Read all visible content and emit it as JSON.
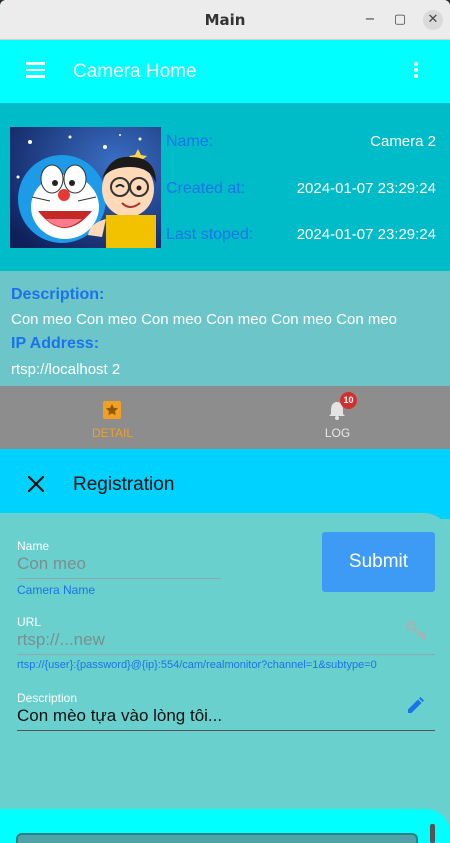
{
  "window": {
    "title": "Main",
    "minimize": "−",
    "maximize": "▢",
    "close": "✕"
  },
  "appbar": {
    "title": "Camera Home",
    "menu_icon": "menu-icon",
    "more_icon": "more-vert-icon"
  },
  "camera": {
    "thumbnail": "doraemon-nobita-image",
    "fields": [
      {
        "label": "Name:",
        "value": "Camera 2"
      },
      {
        "label": "Created at:",
        "value": "2024-01-07 23:29:24"
      },
      {
        "label": "Last stoped:",
        "value": "2024-01-07 23:29:24"
      }
    ],
    "description_label": "Description:",
    "description": "Con meo Con meo Con meo Con meo Con meo Con meo",
    "ip_label": "IP Address:",
    "ip": "rtsp://localhost 2"
  },
  "nav": {
    "detail_label": "DETAIL",
    "log_label": "LOG",
    "log_badge": "10",
    "active_color": "#f2a023"
  },
  "registration": {
    "title": "Registration",
    "name_label": "Name",
    "name_value": "Con meo",
    "name_helper": "Camera Name",
    "submit_label": "Submit",
    "url_label": "URL",
    "url_value": "rtsp://...new",
    "url_helper": "rtsp://{user}:{password}@{ip}:554/cam/realmonitor?channel=1&subtype=0",
    "description_label": "Description",
    "description_value": "Con mèo tựa vào lòng tôi..."
  },
  "colors": {
    "appbar": "#00ffff",
    "card": "#00bcc9",
    "accent_blue": "#1a73e8",
    "submit": "#3d9bf5"
  }
}
